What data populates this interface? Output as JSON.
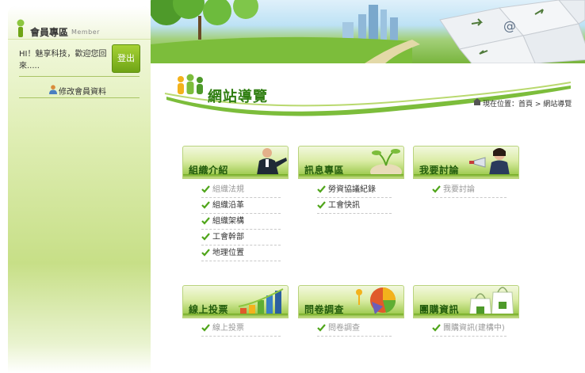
{
  "sidebar": {
    "member_title": "會員專區",
    "member_sub": "Member",
    "greeting": "HI！魅享科技，歡迎您回來.....",
    "logout_label": "登出",
    "edit_profile_label": "修改會員資料"
  },
  "header": {
    "page_title": "網站導覽",
    "breadcrumb": "現在位置：首頁 > 網站導覽"
  },
  "categories": [
    {
      "title": "組織介紹",
      "items": [
        {
          "label": "組織法規",
          "muted": true
        },
        {
          "label": "組織沿革",
          "muted": false
        },
        {
          "label": "組織架構",
          "muted": false
        },
        {
          "label": "工會幹部",
          "muted": false
        },
        {
          "label": "地理位置",
          "muted": false
        }
      ]
    },
    {
      "title": "訊息專區",
      "items": [
        {
          "label": "勞資協議紀錄",
          "muted": false
        },
        {
          "label": "工會快訊",
          "muted": false
        }
      ]
    },
    {
      "title": "我要討論",
      "items": [
        {
          "label": "我要討論",
          "muted": true
        }
      ]
    },
    {
      "title": "線上投票",
      "items": [
        {
          "label": "線上投票",
          "muted": true
        }
      ]
    },
    {
      "title": "問卷調查",
      "items": [
        {
          "label": "問卷調查",
          "muted": true
        }
      ]
    },
    {
      "title": "團購資訊",
      "items": [
        {
          "label": "團購資訊(建構中)",
          "muted": true
        }
      ]
    }
  ],
  "colors": {
    "accent_green": "#6fa416",
    "title_green": "#2f7e11",
    "check_green": "#4fa51a"
  }
}
